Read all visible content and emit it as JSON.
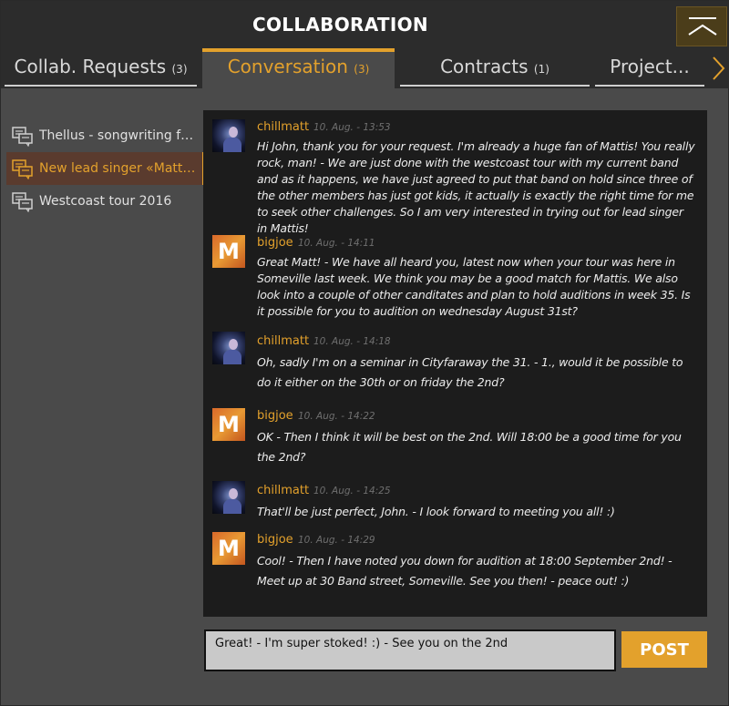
{
  "header": {
    "title": "COLLABORATION"
  },
  "tabs": [
    {
      "label": "Collab. Requests",
      "count": "(3)"
    },
    {
      "label": "Conversation",
      "count": "(3)"
    },
    {
      "label": "Contracts",
      "count": "(1)"
    },
    {
      "label": "Project...",
      "count": ""
    }
  ],
  "sidebar": {
    "items": [
      {
        "label": "Thellus - songwriting for ..."
      },
      {
        "label": "New lead singer «Mattis..."
      },
      {
        "label": "Westcoast tour 2016"
      }
    ]
  },
  "messages": [
    {
      "user": "chillmatt",
      "time": "10. Aug. - 13:53",
      "text": "Hi John, thank you for your request. I'm already a huge fan of Mattis! You really rock, man! - We are just done with the westcoast tour with my current band and as it happens, we have just agreed to put that band on hold since three of the other members has just got kids, it actually is exactly the right time for me to seek other challenges. So I am very interested in trying out for lead singer in Mattis!"
    },
    {
      "user": "bigjoe",
      "time": "10. Aug. - 14:11",
      "text": "Great Matt! - We have all heard you, latest now when your tour was here in Someville last week. We think you may be a good match for Mattis. We also look into a couple of other canditates and plan to hold auditions in week 35. Is it possible for you to audition on wednesday August 31st?"
    },
    {
      "user": "chillmatt",
      "time": "10. Aug. - 14:18",
      "text": "Oh, sadly I'm on a seminar in Cityfaraway the 31. - 1., would it be possible to do it either on the 30th or on friday the 2nd?"
    },
    {
      "user": "bigjoe",
      "time": "10. Aug. - 14:22",
      "text": "OK - Then I think it will be best on the 2nd. Will 18:00 be a good time for you the 2nd?"
    },
    {
      "user": "chillmatt",
      "time": "10. Aug. - 14:25",
      "text": "That'll be just perfect, John. - I look forward to meeting you all! :)"
    },
    {
      "user": "bigjoe",
      "time": "10. Aug. - 14:29",
      "text": "Cool! - Then I have noted you down for audition at 18:00 September 2nd! - Meet up at 30 Band street, Someville. See you then! - peace out! :)"
    }
  ],
  "avatars": {
    "bigjoe_letter": "M"
  },
  "composer": {
    "value": "Great! - I'm super stoked! :) - See you on the 2nd",
    "post_label": "POST"
  },
  "colors": {
    "accent": "#e3a12c",
    "active_item_bg": "#5a3b2e"
  },
  "icons": {
    "collapse": "chevron-up-icon",
    "next": "chevron-right-icon",
    "conversation": "chat-bubbles-icon"
  }
}
